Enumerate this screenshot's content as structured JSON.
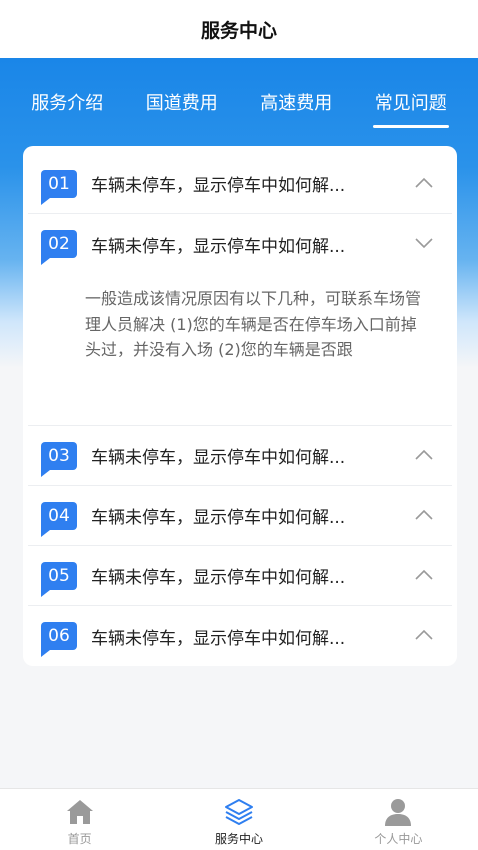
{
  "header": {
    "title": "服务中心"
  },
  "tabs": [
    {
      "label": "服务介绍",
      "active": false
    },
    {
      "label": "国道费用",
      "active": false
    },
    {
      "label": "高速费用",
      "active": false
    },
    {
      "label": "常见问题",
      "active": true
    }
  ],
  "faq": {
    "items": [
      {
        "num": "01",
        "question": "车辆未停车，显示停车中如何解...",
        "expanded": false
      },
      {
        "num": "02",
        "question": "车辆未停车，显示停车中如何解...",
        "expanded": true
      },
      {
        "num": "03",
        "question": "车辆未停车，显示停车中如何解...",
        "expanded": false
      },
      {
        "num": "04",
        "question": "车辆未停车，显示停车中如何解...",
        "expanded": false
      },
      {
        "num": "05",
        "question": "车辆未停车，显示停车中如何解...",
        "expanded": false
      },
      {
        "num": "06",
        "question": "车辆未停车，显示停车中如何解...",
        "expanded": false
      }
    ],
    "answer": "一般造成该情况原因有以下几种，可联系车场管理人员解决 (1)您的车辆是否在停车场入口前掉头过，并没有入场 (2)您的车辆是否跟"
  },
  "tabbar": [
    {
      "label": "首页",
      "icon": "home-icon",
      "active": false
    },
    {
      "label": "服务中心",
      "icon": "layers-icon",
      "active": true
    },
    {
      "label": "个人中心",
      "icon": "user-icon",
      "active": false
    }
  ],
  "colors": {
    "accent": "#2f7ff0",
    "banner": "#1a86e8"
  }
}
